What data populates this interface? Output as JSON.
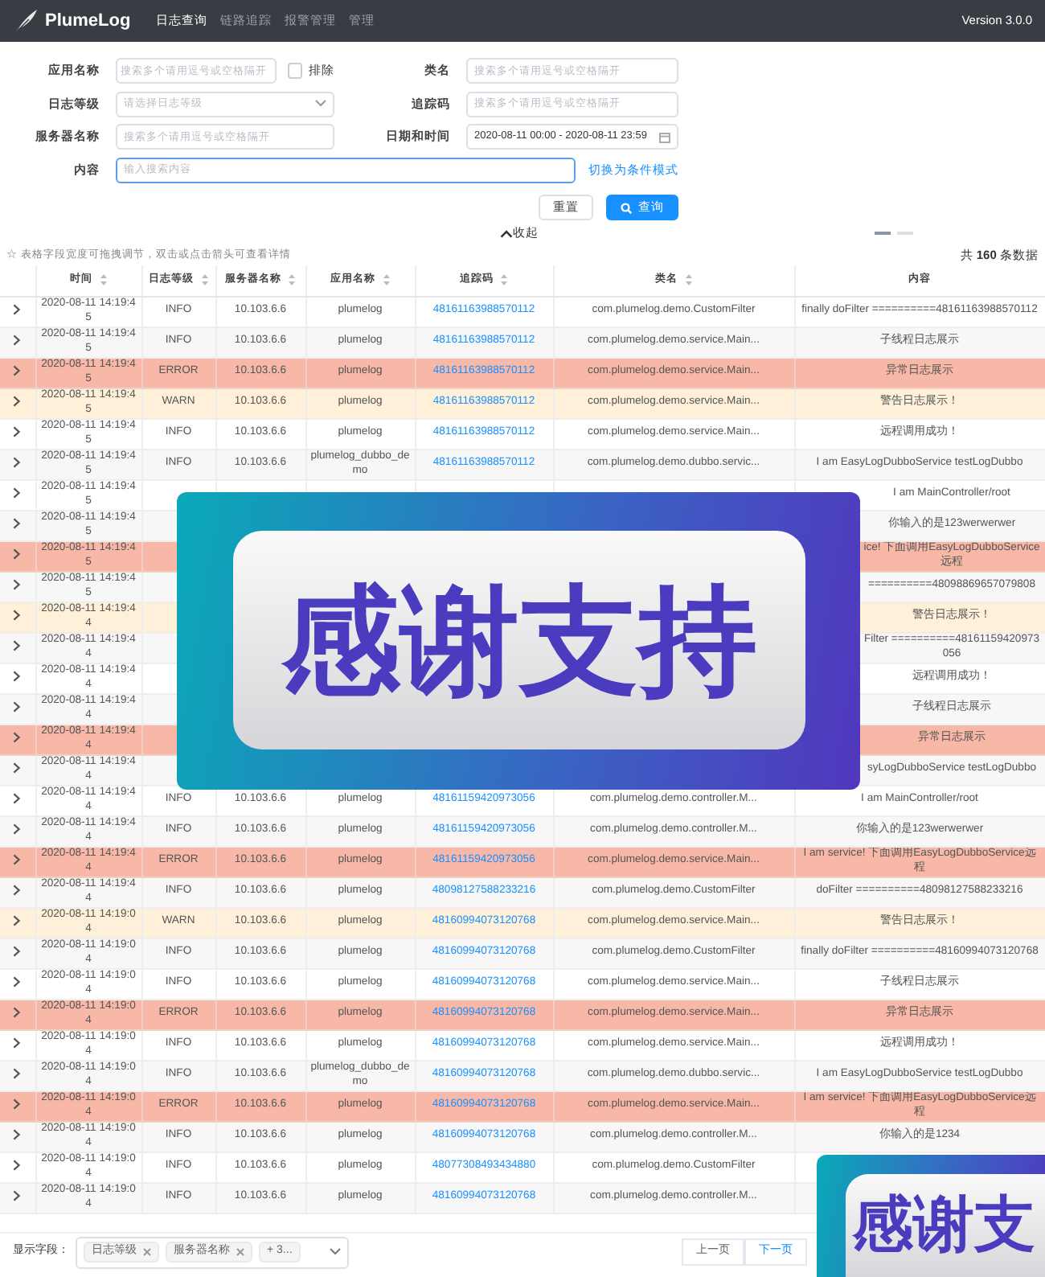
{
  "nav": {
    "brand": "PlumeLog",
    "items": [
      {
        "label": "日志查询",
        "selected": true
      },
      {
        "label": "链路追踪",
        "selected": false
      },
      {
        "label": "报警管理",
        "selected": false
      },
      {
        "label": "管理",
        "selected": false
      }
    ],
    "version": "Version 3.0.0"
  },
  "form": {
    "app_name": {
      "label": "应用名称",
      "placeholder": "搜索多个请用逗号或空格隔开"
    },
    "exclude": {
      "label": "排除",
      "checked": false
    },
    "class_name": {
      "label": "类名",
      "placeholder": "搜索多个请用逗号或空格隔开"
    },
    "log_level": {
      "label": "日志等级",
      "placeholder": "请选择日志等级"
    },
    "trace_id": {
      "label": "追踪码",
      "placeholder": "搜索多个请用逗号或空格隔开"
    },
    "server_name": {
      "label": "服务器名称",
      "placeholder": "搜索多个请用逗号或空格隔开"
    },
    "datetime": {
      "label": "日期和时间",
      "value": "2020-08-11 00:00 - 2020-08-11 23:59"
    },
    "content": {
      "label": "内容",
      "placeholder": "输入搜索内容"
    },
    "switch_link": "切换为条件模式",
    "reset_button": "重置",
    "search_button": "查询",
    "collapse": "收起"
  },
  "indicators": [
    {
      "selected": true
    },
    {
      "selected": false
    }
  ],
  "hint": "☆ 表格字段宽度可拖拽调节，双击或点击箭头可查看详情",
  "total": "共 **160** 条数据",
  "table": {
    "columns": [
      {
        "label": "时间",
        "sortable": true
      },
      {
        "label": "日志等级",
        "sortable": true
      },
      {
        "label": "服务器名称",
        "sortable": true
      },
      {
        "label": "应用名称",
        "sortable": true
      },
      {
        "label": "追踪码",
        "sortable": true
      },
      {
        "label": "类名",
        "sortable": true
      },
      {
        "label": "内容",
        "sortable": false
      }
    ],
    "rows": [
      {
        "kind": "info",
        "time": "2020-08-11 14:19:45",
        "log_level": "INFO",
        "server": "10.103.6.6",
        "app": "plumelog",
        "trace_id": "48161163988570112",
        "class_name": "com.plumelog.demo.CustomFilter",
        "content": "finally doFilter ==========48161163988570112"
      },
      {
        "kind": "info",
        "time": "2020-08-11 14:19:45",
        "log_level": "INFO",
        "server": "10.103.6.6",
        "app": "plumelog",
        "trace_id": "48161163988570112",
        "class_name": "com.plumelog.demo.service.Main...",
        "content": "子线程日志展示"
      },
      {
        "kind": "error",
        "time": "2020-08-11 14:19:45",
        "log_level": "ERROR",
        "server": "10.103.6.6",
        "app": "plumelog",
        "trace_id": "48161163988570112",
        "class_name": "com.plumelog.demo.service.Main...",
        "content": "异常日志展示"
      },
      {
        "kind": "warn",
        "time": "2020-08-11 14:19:45",
        "log_level": "WARN",
        "server": "10.103.6.6",
        "app": "plumelog",
        "trace_id": "48161163988570112",
        "class_name": "com.plumelog.demo.service.Main...",
        "content": "警告日志展示！"
      },
      {
        "kind": "info",
        "time": "2020-08-11 14:19:45",
        "log_level": "INFO",
        "server": "10.103.6.6",
        "app": "plumelog",
        "trace_id": "48161163988570112",
        "class_name": "com.plumelog.demo.service.Main...",
        "content": "远程调用成功！"
      },
      {
        "kind": "info",
        "time": "2020-08-11 14:19:45",
        "log_level": "INFO",
        "server": "10.103.6.6",
        "app": "plumelog_dubbo_demo",
        "trace_id": "48161163988570112",
        "class_name": "com.plumelog.demo.dubbo.servic...",
        "content": "I am EasyLogDubboService testLogDubbo"
      },
      {
        "kind": "info",
        "time": "2020-08-11 14:19:45",
        "content": "I am MainController/root"
      },
      {
        "kind": "info",
        "time": "2020-08-11 14:19:45",
        "content": "你输入的是123werwerwer"
      },
      {
        "kind": "error",
        "time": "2020-08-11 14:19:45",
        "content": "ice! 下面调用EasyLogDubboService远程"
      },
      {
        "kind": "info",
        "time": "2020-08-11 14:19:45",
        "content": "==========48098869657079808"
      },
      {
        "kind": "warn",
        "time": "2020-08-11 14:19:44",
        "content": "警告日志展示！"
      },
      {
        "kind": "info",
        "time": "2020-08-11 14:19:44",
        "content": "Filter ==========48161159420973056"
      },
      {
        "kind": "info",
        "time": "2020-08-11 14:19:44",
        "content": "远程调用成功！"
      },
      {
        "kind": "info",
        "time": "2020-08-11 14:19:44",
        "content": "子线程日志展示"
      },
      {
        "kind": "error",
        "time": "2020-08-11 14:19:44",
        "content": "异常日志展示"
      },
      {
        "kind": "info",
        "time": "2020-08-11 14:19:44",
        "content": "syLogDubboService testLogDubbo"
      },
      {
        "kind": "info",
        "time": "2020-08-11 14:19:44",
        "log_level": "INFO",
        "server": "10.103.6.6",
        "app": "plumelog",
        "trace_id": "48161159420973056",
        "class_name": "com.plumelog.demo.controller.M...",
        "content": "I am MainController/root"
      },
      {
        "kind": "info",
        "time": "2020-08-11 14:19:44",
        "log_level": "INFO",
        "server": "10.103.6.6",
        "app": "plumelog",
        "trace_id": "48161159420973056",
        "class_name": "com.plumelog.demo.controller.M...",
        "content": "你输入的是123werwerwer"
      },
      {
        "kind": "error",
        "time": "2020-08-11 14:19:44",
        "log_level": "ERROR",
        "server": "10.103.6.6",
        "app": "plumelog",
        "trace_id": "48161159420973056",
        "class_name": "com.plumelog.demo.service.Main...",
        "content": "I am service! 下面调用EasyLogDubboService远程"
      },
      {
        "kind": "info",
        "time": "2020-08-11 14:19:44",
        "log_level": "INFO",
        "server": "10.103.6.6",
        "app": "plumelog",
        "trace_id": "48098127588233216",
        "class_name": "com.plumelog.demo.CustomFilter",
        "content": "doFilter ==========48098127588233216"
      },
      {
        "kind": "warn",
        "time": "2020-08-11 14:19:04",
        "log_level": "WARN",
        "server": "10.103.6.6",
        "app": "plumelog",
        "trace_id": "48160994073120768",
        "class_name": "com.plumelog.demo.service.Main...",
        "content": "警告日志展示！"
      },
      {
        "kind": "info",
        "time": "2020-08-11 14:19:04",
        "log_level": "INFO",
        "server": "10.103.6.6",
        "app": "plumelog",
        "trace_id": "48160994073120768",
        "class_name": "com.plumelog.demo.CustomFilter",
        "content": "finally doFilter ==========48160994073120768"
      },
      {
        "kind": "info",
        "time": "2020-08-11 14:19:04",
        "log_level": "INFO",
        "server": "10.103.6.6",
        "app": "plumelog",
        "trace_id": "48160994073120768",
        "class_name": "com.plumelog.demo.service.Main...",
        "content": "子线程日志展示"
      },
      {
        "kind": "error",
        "time": "2020-08-11 14:19:04",
        "log_level": "ERROR",
        "server": "10.103.6.6",
        "app": "plumelog",
        "trace_id": "48160994073120768",
        "class_name": "com.plumelog.demo.service.Main...",
        "content": "异常日志展示"
      },
      {
        "kind": "info",
        "time": "2020-08-11 14:19:04",
        "log_level": "INFO",
        "server": "10.103.6.6",
        "app": "plumelog",
        "trace_id": "48160994073120768",
        "class_name": "com.plumelog.demo.service.Main...",
        "content": "远程调用成功！"
      },
      {
        "kind": "info",
        "time": "2020-08-11 14:19:04",
        "log_level": "INFO",
        "server": "10.103.6.6",
        "app": "plumelog_dubbo_demo",
        "trace_id": "48160994073120768",
        "class_name": "com.plumelog.demo.dubbo.servic...",
        "content": "I am EasyLogDubboService testLogDubbo"
      },
      {
        "kind": "error",
        "time": "2020-08-11 14:19:04",
        "log_level": "ERROR",
        "server": "10.103.6.6",
        "app": "plumelog",
        "trace_id": "48160994073120768",
        "class_name": "com.plumelog.demo.service.Main...",
        "content": "I am service! 下面调用EasyLogDubboService远程"
      },
      {
        "kind": "info",
        "time": "2020-08-11 14:19:04",
        "log_level": "INFO",
        "server": "10.103.6.6",
        "app": "plumelog",
        "trace_id": "48160994073120768",
        "class_name": "com.plumelog.demo.controller.M...",
        "content": "你输入的是1234"
      },
      {
        "kind": "info",
        "time": "2020-08-11 14:19:04",
        "log_level": "INFO",
        "server": "10.103.6.6",
        "app": "plumelog",
        "trace_id": "48077308493434880",
        "class_name": "com.plumelog.demo.CustomFilter"
      },
      {
        "kind": "info",
        "time": "2020-08-11 14:19:04",
        "log_level": "INFO",
        "server": "10.103.6.6",
        "app": "plumelog",
        "trace_id": "48160994073120768",
        "class_name": "com.plumelog.demo.controller.M..."
      }
    ]
  },
  "display_fields": {
    "label": "显示字段：",
    "tags": [
      "日志等级",
      "服务器名称"
    ],
    "more": "+ 3..."
  },
  "pager": {
    "prev": "上一页",
    "next": "下一页"
  },
  "banners": [
    {
      "kind": "large",
      "text": "感谢支持"
    },
    {
      "kind": "corner",
      "text": "感谢支"
    }
  ]
}
